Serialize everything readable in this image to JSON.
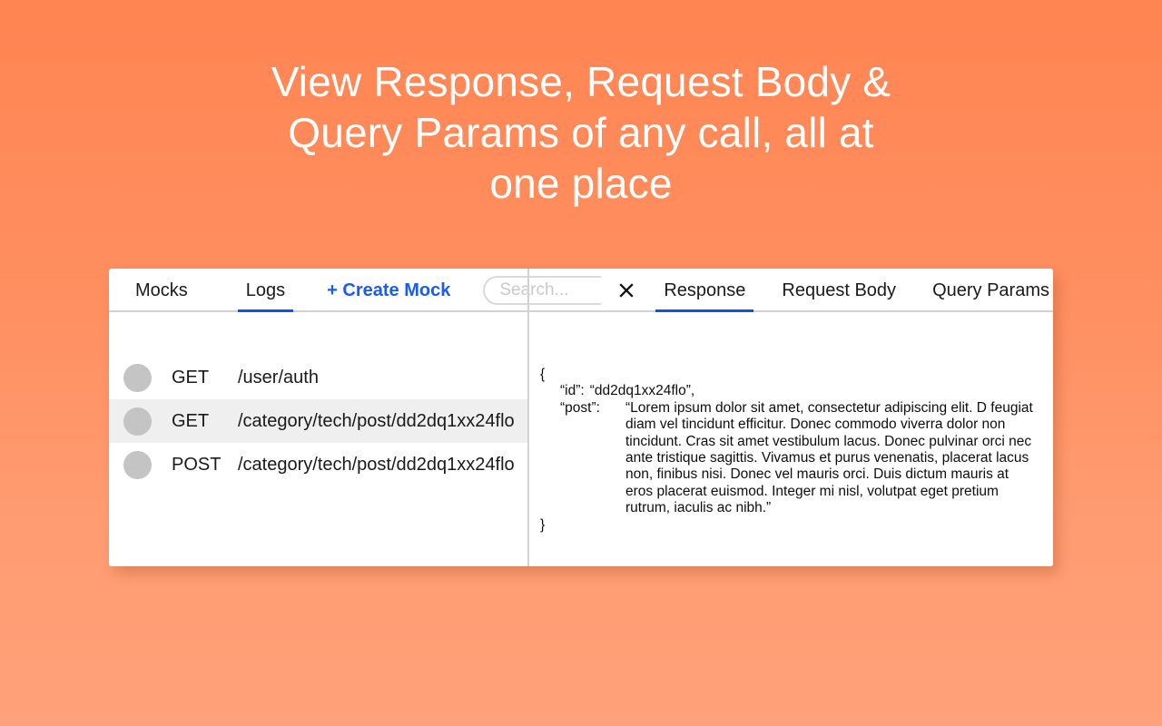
{
  "headline": "View Response, Request Body &\nQuery Params of any call, all at\none place",
  "theme": {
    "background_top": "#FF8552",
    "background_bottom": "#FFA17A",
    "accent_blue": "#0B57E3",
    "link_blue": "#1A5CF0",
    "panel_bg": "#FFFFFF",
    "row_selected_bg": "#EFEFEF",
    "dot_gray": "#C4C4C4",
    "divider_gray": "#D2D2D2"
  },
  "left_panel": {
    "tabs": [
      {
        "label": "Mocks",
        "active": false
      },
      {
        "label": "Logs",
        "active": true
      }
    ],
    "create_mock_label": "+ Create Mock",
    "search": {
      "value": "",
      "placeholder": "Search..."
    },
    "requests": [
      {
        "status_icon": "status-dot-icon",
        "method": "GET",
        "path": "/user/auth",
        "selected": false
      },
      {
        "status_icon": "status-dot-icon",
        "method": "GET",
        "path": "/category/tech/post/dd2dq1xx24flo",
        "selected": true
      },
      {
        "status_icon": "status-dot-icon",
        "method": "POST",
        "path": "/category/tech/post/dd2dq1xx24flo",
        "selected": false
      }
    ]
  },
  "right_panel": {
    "close_icon": "close-icon",
    "tabs": [
      {
        "label": "Response",
        "active": true
      },
      {
        "label": "Request Body",
        "active": false
      },
      {
        "label": "Query Params",
        "active": false
      }
    ],
    "response": {
      "open_brace": "{",
      "close_brace": "}",
      "id_key": "“id”:",
      "id_value": "“dd2dq1xx24flo”,",
      "post_key": "“post”:",
      "post_value": "“Lorem ipsum dolor sit amet, consectetur adipiscing elit. D feugiat diam vel tincidunt efficitur. Donec commodo viverra dolor non tincidunt. Cras sit amet vestibulum lacus. Donec pulvinar orci nec ante tristique sagittis. Vivamus et purus venenatis, placerat lacus non, finibus nisi. Donec vel mauris orci. Duis dictum mauris at eros placerat euismod. Integer mi nisl, volutpat eget pretium rutrum, iaculis ac nibh.”"
    }
  }
}
